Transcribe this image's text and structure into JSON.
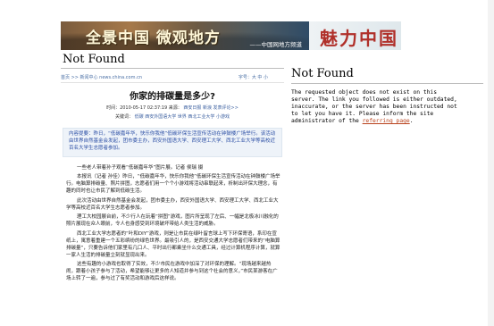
{
  "banner": {
    "title": "全景中国 微观地方",
    "subtitle": "——中国网地方频道",
    "logo": "魅力中国"
  },
  "left_heading": "Not Found",
  "article": {
    "breadcrumb": "首页 >> 新闻中心 news.china.com.cn",
    "font_size_label": "字号：大 中 小",
    "title": "你家的排碳量是多少?",
    "meta_time": "时间：2010-05-17 02:37:19  来源：",
    "meta_source": "西安日报 新浪",
    "meta_comment": "发表评论>>",
    "keywords_label": "关键词：",
    "keywords": "低碳 西安外国语大学 世界 西北工业大学 小游戏",
    "summary": "内容提要：昨日，“低碳嘉年华，快乐你我他”低碳环保生活宣传活动在钟鼓楼广场举行。该活动由世界自然基金会发起，团市委主办，西安外国语大学、西安理工大学、西北工业大学等高校近百名大学生志愿者参加。",
    "paragraphs": [
      "一些老人带着孙子观看“低碳嘉年华”图片展。记者 侯瑞 摄",
      "本报讯（记者 孙佳）昨日，“低碳嘉年华，快乐你我他”低碳环保生活宣传活动在钟鼓楼广场举行。电脑算排碳量、照片拼图，志愿者们用一个个小游戏将活动串联起来，析制出环保大理念，有趣的同时也让市民了解到低碳生活。",
      "此次活动由世界自然基金会发起，团市委主办，西安外国语大学、西安理工大学、西北工业大学等高校近百名大学生志愿者参加。",
      "理工大校园展台前，不少行人在玩着“拼图”游戏，图片所呈现了左后、一幅是北极冰川融化的照片展现在众人眼前，令人也身感受到环境破坏带给人类生活的威胁。",
      "西北工业大学志愿者的“叶和DIY”游戏，则是让市民在绿叶留言球上写下环保寄语，系印在宣纸上，寓意着重建一个五彩缤纷的绿色世界。最吸引人的，是西安交通大学志愿者们带来的“电脑算排碳量”，只要告诉他们家里有几口人、平时出行都乘坐什么交通工具，经过计算机程序计算，就算一家人生活的排碳量立刻就显现出来。",
      "这些有趣的小游戏也取得了实效，不少市民在游戏中加深了对环保的理解。“现场越来越热闹，跟着小孩子参与了活动，希望能够让更多的人知道并参与到这个社会的意义，”市民某游客在广场上转了一遍，参与过了有奖活动和游戏后这样说。"
    ]
  },
  "right_heading": "Not Found",
  "error_message_before": "The requested object does not exist on this server. The link you followed is either outdated, inaccurate, or the server has been instructed not to let you have it. Please inform the site administrator of the ",
  "error_link": "referring page",
  "error_message_after": "."
}
